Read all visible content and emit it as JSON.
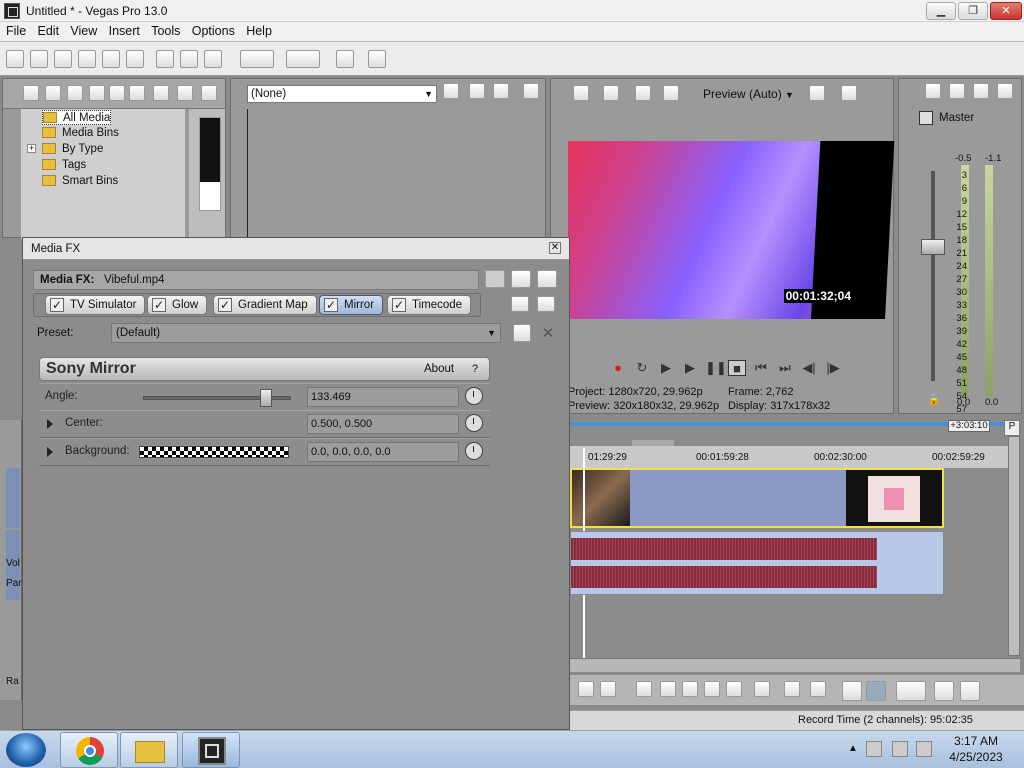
{
  "window": {
    "title": "Untitled * - Vegas Pro 13.0",
    "min": "▁",
    "max": "❐",
    "close": "✕"
  },
  "menu": [
    "File",
    "Edit",
    "View",
    "Insert",
    "Tools",
    "Options",
    "Help"
  ],
  "explorer": {
    "items": [
      {
        "label": "All Media",
        "selected": true
      },
      {
        "label": "Media Bins"
      },
      {
        "label": "By Type",
        "expand": "+"
      },
      {
        "label": "Tags"
      },
      {
        "label": "Smart Bins"
      }
    ]
  },
  "transitions": {
    "dropdown": "(None)"
  },
  "media_fx": {
    "window_title": "Media FX",
    "header_label": "Media FX:",
    "header_file": "Vibeful.mp4",
    "chain": [
      "TV Simulator",
      "Glow",
      "Gradient Map",
      "Mirror",
      "Timecode"
    ],
    "active_chain_item": "Mirror",
    "preset_label": "Preset:",
    "preset_value": "(Default)",
    "plugin_name": "Sony Mirror",
    "about": "About",
    "help": "?",
    "params": {
      "angle_label": "Angle:",
      "angle_value": "133.469",
      "angle_fraction": 0.86,
      "center_label": "Center:",
      "center_value": "0.500, 0.500",
      "background_label": "Background:",
      "background_value": "0.0, 0.0, 0.0, 0.0"
    }
  },
  "preview": {
    "mode": "Preview (Auto)",
    "timecode": "00:01:32;04",
    "project_label": "Project:",
    "project_value": "1280x720, 29.962p",
    "preview_label": "Preview:",
    "preview_value": "320x180x32, 29.962p",
    "frame_label": "Frame:",
    "frame_value": "2,762",
    "display_label": "Display:",
    "display_value": "317x178x32"
  },
  "mixer": {
    "label": "Master",
    "peak_left": "-0.5",
    "peak_right": "-1.1",
    "scale": [
      "3",
      "6",
      "9",
      "12",
      "15",
      "18",
      "21",
      "24",
      "27",
      "30",
      "33",
      "36",
      "39",
      "42",
      "45",
      "48",
      "51",
      "54",
      "57"
    ],
    "bottom_left": "0.0",
    "bottom_right": "0.0"
  },
  "timeline": {
    "offset": "+3:03:10",
    "ticks": [
      "01:29:29",
      "00:01:59:28",
      "00:02:30:00",
      "00:02:59:29"
    ]
  },
  "left_tracks": {
    "vol": "Vol",
    "pan": "Pan",
    "rate": "Ra"
  },
  "status": {
    "record_time": "Record Time (2 channels): 95:02:35"
  },
  "taskbar": {
    "time": "3:17 AM",
    "date": "4/25/2023"
  },
  "colors": {
    "accent": "#f0e050",
    "audio_wave": "#8a2a3a",
    "video_track": "#8b9ac4"
  }
}
